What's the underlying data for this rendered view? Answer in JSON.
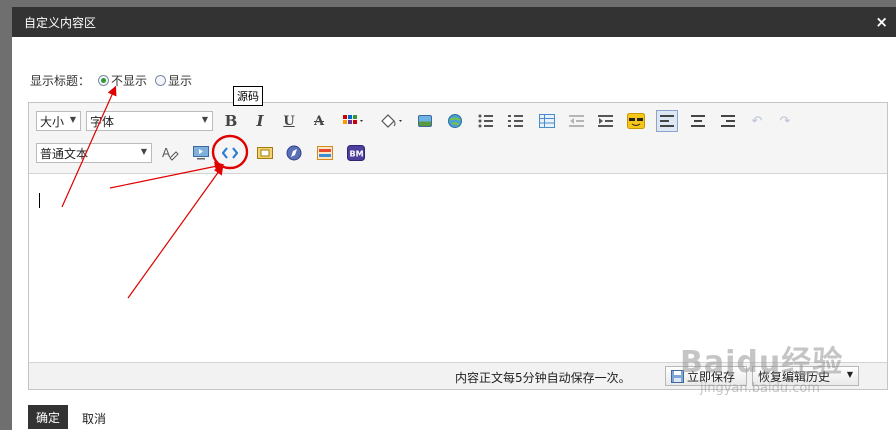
{
  "dialog": {
    "title": "自定义内容区",
    "close_glyph": "×"
  },
  "show_title": {
    "label": "显示标题：",
    "options": [
      {
        "label": "不显示",
        "checked": true
      },
      {
        "label": "显示",
        "checked": false
      }
    ]
  },
  "toolbar": {
    "size_select": "大小",
    "font_select": "字体",
    "format_select": "普通文本",
    "bold": "B",
    "italic": "I",
    "underline": "U",
    "strike": "A",
    "tooltip": "源码"
  },
  "statusbar": {
    "autosave_text": "内容正文每5分钟自动保存一次。",
    "save_now": "立即保存",
    "restore_history": "恢复编辑历史"
  },
  "footer": {
    "ok": "确定",
    "cancel": "取消"
  },
  "watermark": {
    "line1": "Baidu经验",
    "line2": "jingyan.baidu.com"
  },
  "colors": {
    "dialog_title_bg": "#333333",
    "annotation_red": "#e00000",
    "radio_checked": "#2e9a2e",
    "active_button_bg": "#dde7f3"
  }
}
